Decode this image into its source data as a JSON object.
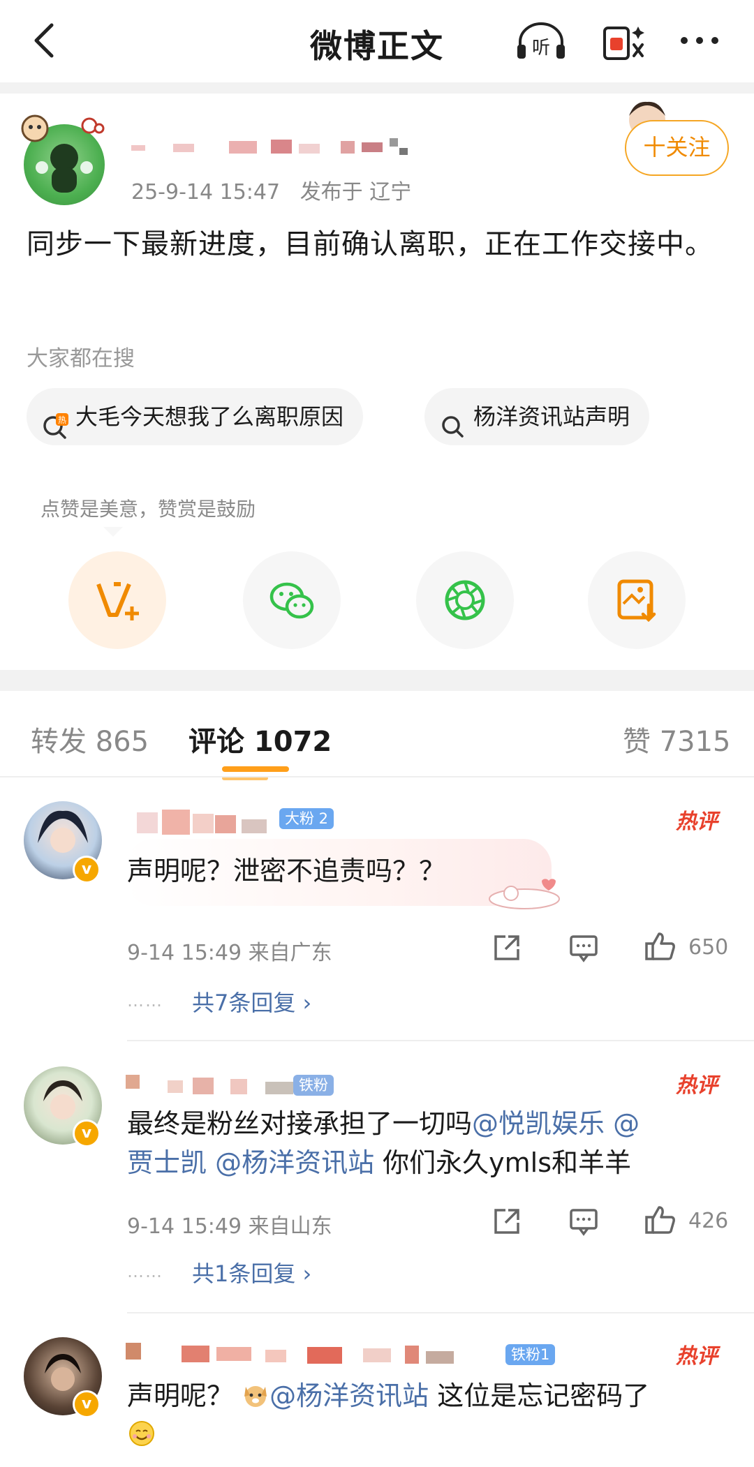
{
  "header": {
    "title": "微博正文",
    "listen_label": "听"
  },
  "post": {
    "date": "25-9-14 15:47",
    "location": "发布于 辽宁",
    "follow_label": "十关注",
    "text": "同步一下最新进度，目前确认离职，正在工作交接中。"
  },
  "search": {
    "label": "大家都在搜",
    "chips": [
      {
        "text": "大毛今天想我了么离职原因",
        "icon": "hot-search-icon",
        "badge": "热"
      },
      {
        "text": "杨洋资讯站声明",
        "icon": "search-icon"
      }
    ]
  },
  "reward_tip": "点赞是美意，赞赏是鼓励",
  "actions": [
    {
      "name": "reward-icon"
    },
    {
      "name": "wechat-icon"
    },
    {
      "name": "moments-icon"
    },
    {
      "name": "save-image-icon"
    }
  ],
  "tabs": {
    "repost": "转发 865",
    "comments": "评论 1072",
    "likes": "赞 7315"
  },
  "comments": [
    {
      "fan_badge": "大粉 2",
      "hot_label": "热评",
      "text": "声明呢？泄密不追责吗？？",
      "time": "9-14 15:49 来自广东",
      "likes": "650",
      "reply_dots": "……",
      "replies": "共7条回复 ›"
    },
    {
      "fan_badge": "铁粉",
      "hot_label": "热评",
      "text_plain": "最终是粉丝对接承担了一切吗",
      "mention1": "@悦凯娱乐 @",
      "mention2": "贾士凯 @杨洋资讯站",
      "text_tail": " 你们永久ymls和羊羊",
      "time": "9-14 15:49 来自山东",
      "likes": "426",
      "reply_dots": "……",
      "replies": "共1条回复 ›"
    },
    {
      "fan_badge": "铁粉1",
      "hot_label": "热评",
      "text_plain": "声明呢？",
      "mention": "@杨洋资讯站",
      "text_tail": " 这位是忘记密码了"
    }
  ],
  "colors": {
    "accent": "#f5a623",
    "link": "#4a6fa8",
    "hot": "#e8412c",
    "wechat_green": "#35c24a"
  }
}
